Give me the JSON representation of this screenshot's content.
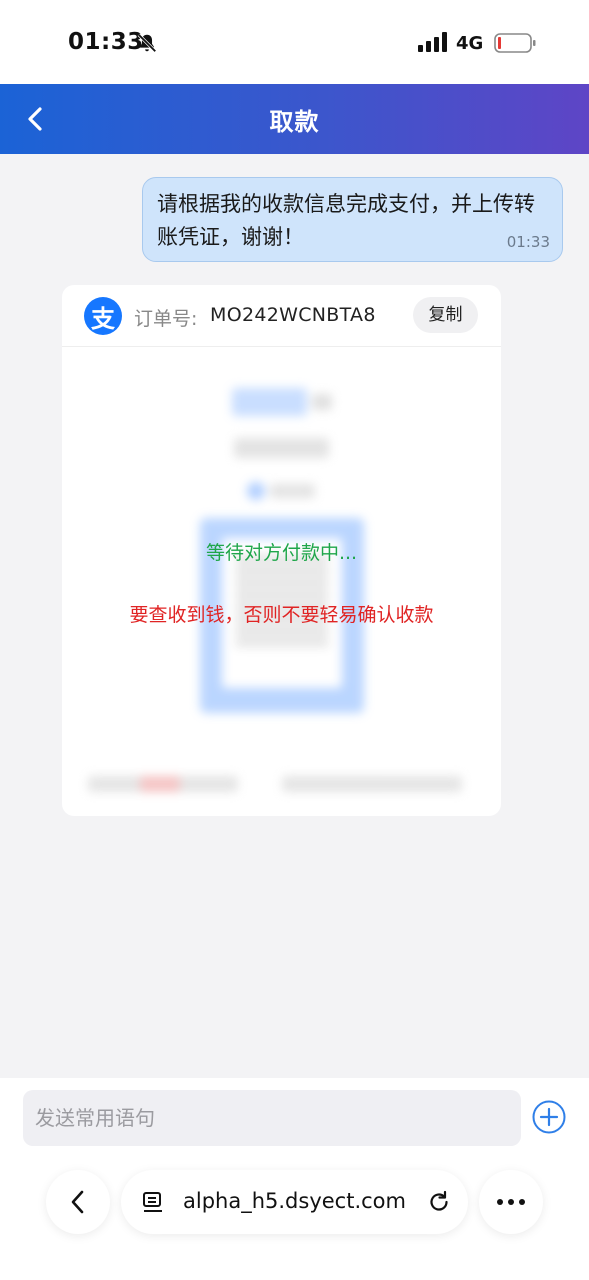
{
  "status_bar": {
    "time": "01:33",
    "network": "4G",
    "icons": [
      "bell-slash-icon",
      "signal-icon",
      "battery-icon"
    ]
  },
  "header": {
    "title": "取款",
    "back_icon": "chevron-left-icon",
    "gradient_colors": [
      "#1b63d6",
      "#5e45c6"
    ]
  },
  "chat": {
    "message": "请根据我的收款信息完成支付，并上传转账凭证，谢谢！",
    "time": "01:33"
  },
  "payment_card": {
    "logo_char": "支",
    "order_label": "订单号:",
    "order_number": "MO242WCNBTA8",
    "copy_label": "复制",
    "waiting_text": "等待对方付款中...",
    "warning_text": "要查收到钱，否则不要轻易确认收款",
    "colors": {
      "waiting": "#1fa64a",
      "warning": "#e02424",
      "brand": "#1677ff"
    }
  },
  "input": {
    "placeholder": "发送常用语句",
    "value": ""
  },
  "browser": {
    "url": "alpha_h5.dsyect.com",
    "icons": [
      "chevron-left-icon",
      "tabs-icon",
      "reload-icon",
      "more-icon"
    ]
  }
}
